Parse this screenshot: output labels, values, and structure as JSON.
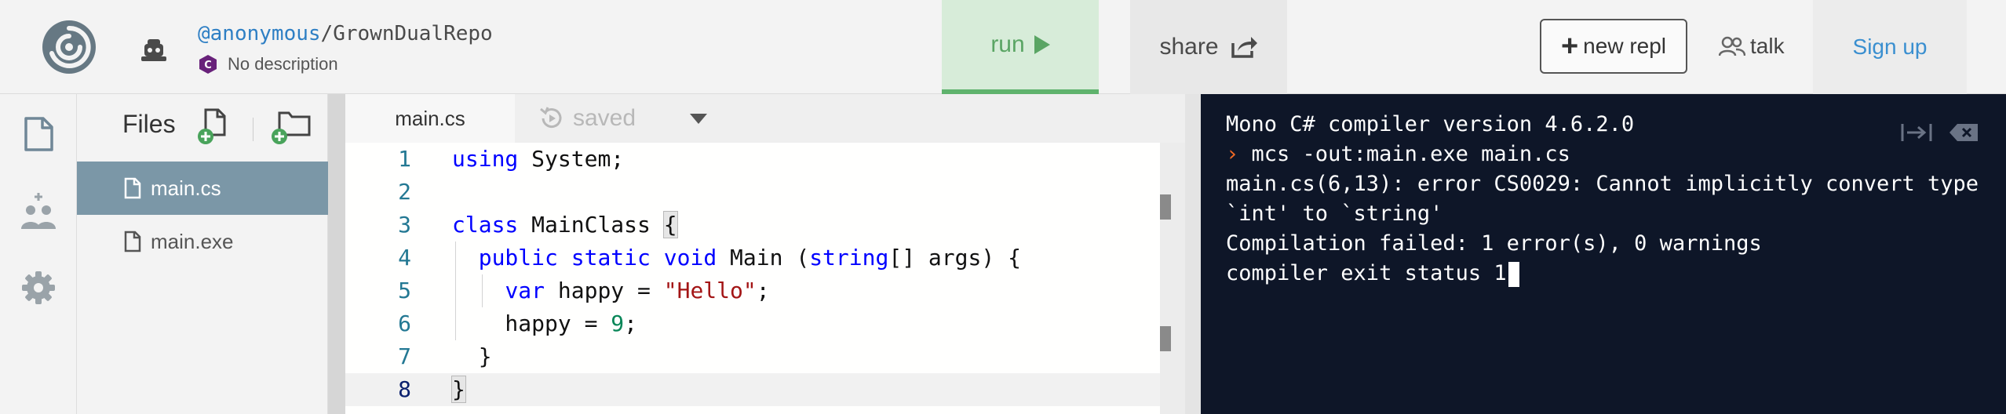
{
  "header": {
    "repl_user": "@anonymous",
    "repl_separator": "/",
    "repl_name": "GrownDualRepo",
    "description": "No description",
    "run_label": "run",
    "share_label": "share",
    "new_repl_label": "new repl",
    "talk_label": "talk",
    "signup_label": "Sign up"
  },
  "files": {
    "title": "Files",
    "items": [
      {
        "name": "main.cs",
        "active": true
      },
      {
        "name": "main.exe",
        "active": false
      }
    ]
  },
  "editor": {
    "tab_label": "main.cs",
    "saved_label": "saved",
    "line_numbers": [
      "1",
      "2",
      "3",
      "4",
      "5",
      "6",
      "7",
      "8"
    ],
    "code_lines": [
      "using System;",
      "",
      "class MainClass {",
      "  public static void Main (string[] args) {",
      "    var happy = \"Hello\";",
      "    happy = 9;",
      "  }",
      "}"
    ]
  },
  "console": {
    "lines": [
      "Mono C# compiler version 4.6.2.0",
      "mcs -out:main.exe main.cs",
      "main.cs(6,13): error CS0029: Cannot implicitly convert type",
      "`int' to `string'",
      "Compilation failed: 1 error(s), 0 warnings",
      "compiler exit status 1"
    ],
    "prompt_symbol": "›"
  },
  "colors": {
    "run_bg": "#d7ecd9",
    "run_accent": "#5fb36d",
    "file_active_bg": "#7b97a7",
    "console_bg": "#0e1628",
    "prompt": "#f26b25",
    "link": "#3a8fd0"
  },
  "icons": {
    "logo": "replit-logo-icon",
    "avatar": "anonymous-avatar-icon",
    "language": "csharp-icon",
    "run": "play-icon",
    "share": "share-icon",
    "rail": [
      "files-icon",
      "multiplayer-icon",
      "settings-icon"
    ],
    "files_actions": [
      "new-file-icon",
      "new-folder-icon"
    ],
    "console": [
      "clear-console-icon",
      "delete-icon"
    ]
  }
}
